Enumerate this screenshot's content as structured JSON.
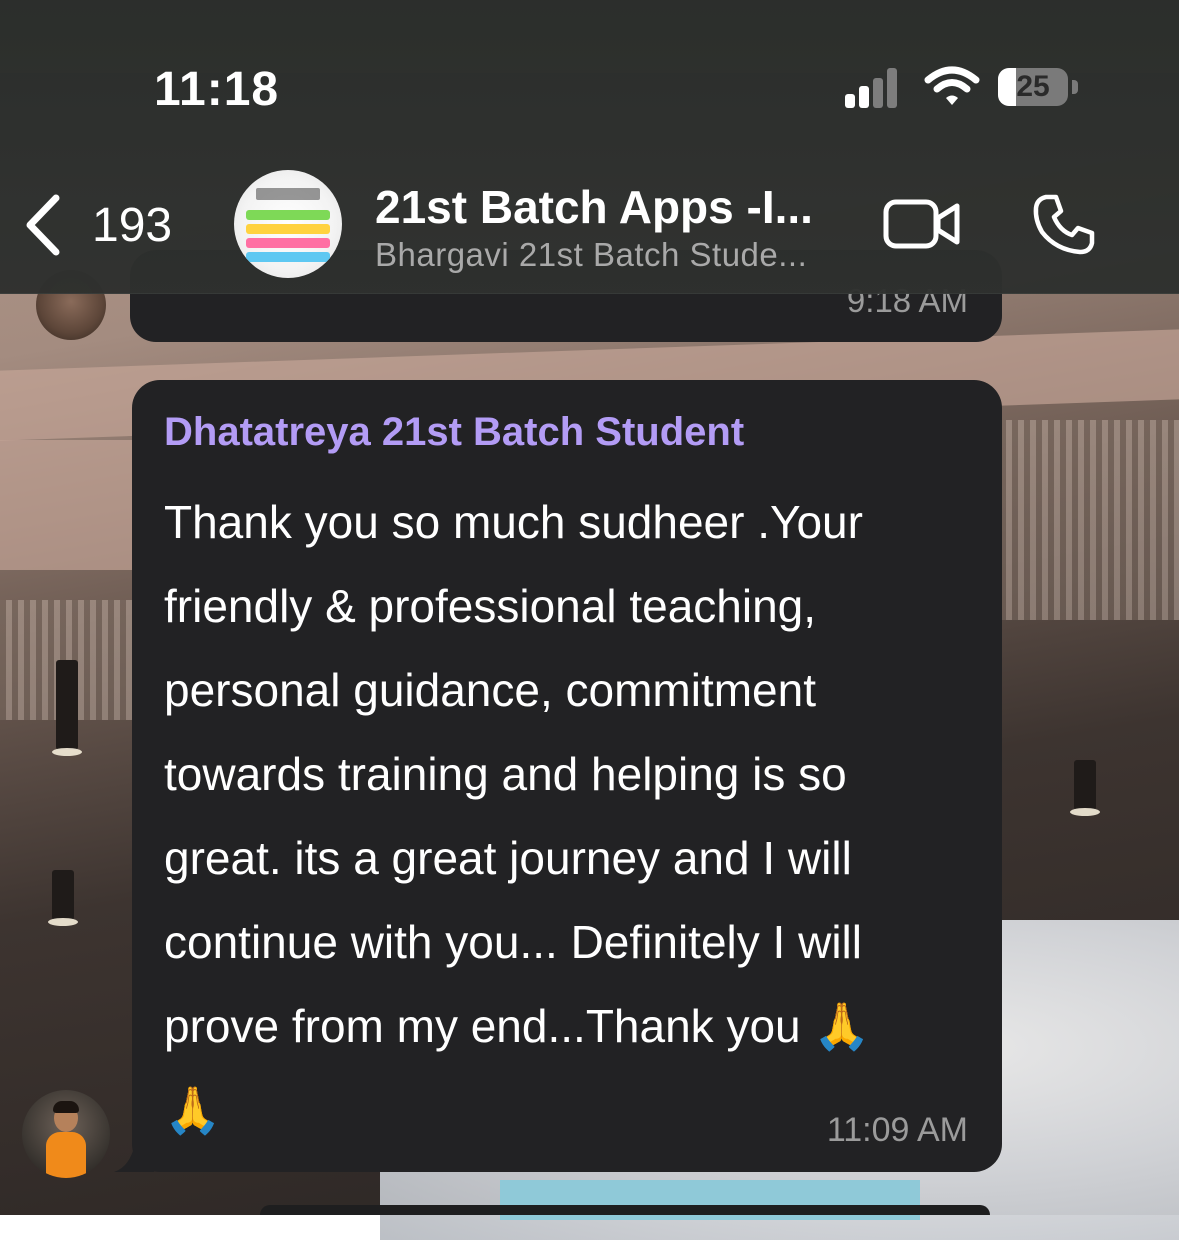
{
  "status_bar": {
    "time": "11:18",
    "battery_percent": "25",
    "battery_level": 0.25,
    "signal_icon": "cellular-signal-icon",
    "wifi_icon": "wifi-icon"
  },
  "header": {
    "back_count": "193",
    "title": "21st Batch Apps -I...",
    "subtitle": "Bhargavi 21st Batch Stude...",
    "video_icon": "video-camera-icon",
    "call_icon": "phone-icon"
  },
  "messages": [
    {
      "time": "9:18 AM"
    },
    {
      "sender": "Dhatatreya 21st Batch Student",
      "sender_color": "#b39cf5",
      "text": "Thank you so much sudheer .Your\nfriendly & professional teaching,\npersonal guidance, commitment\ntowards training and helping is so\ngreat.  its a great journey and I will\ncontinue with you... Definitely I will\nprove from my end...Thank you 🙏\n🙏",
      "time": "11:09 AM"
    }
  ],
  "colors": {
    "bubble": "#222224",
    "header_bg": "#2c2f2d",
    "timestamp": "#9b9b9b"
  }
}
